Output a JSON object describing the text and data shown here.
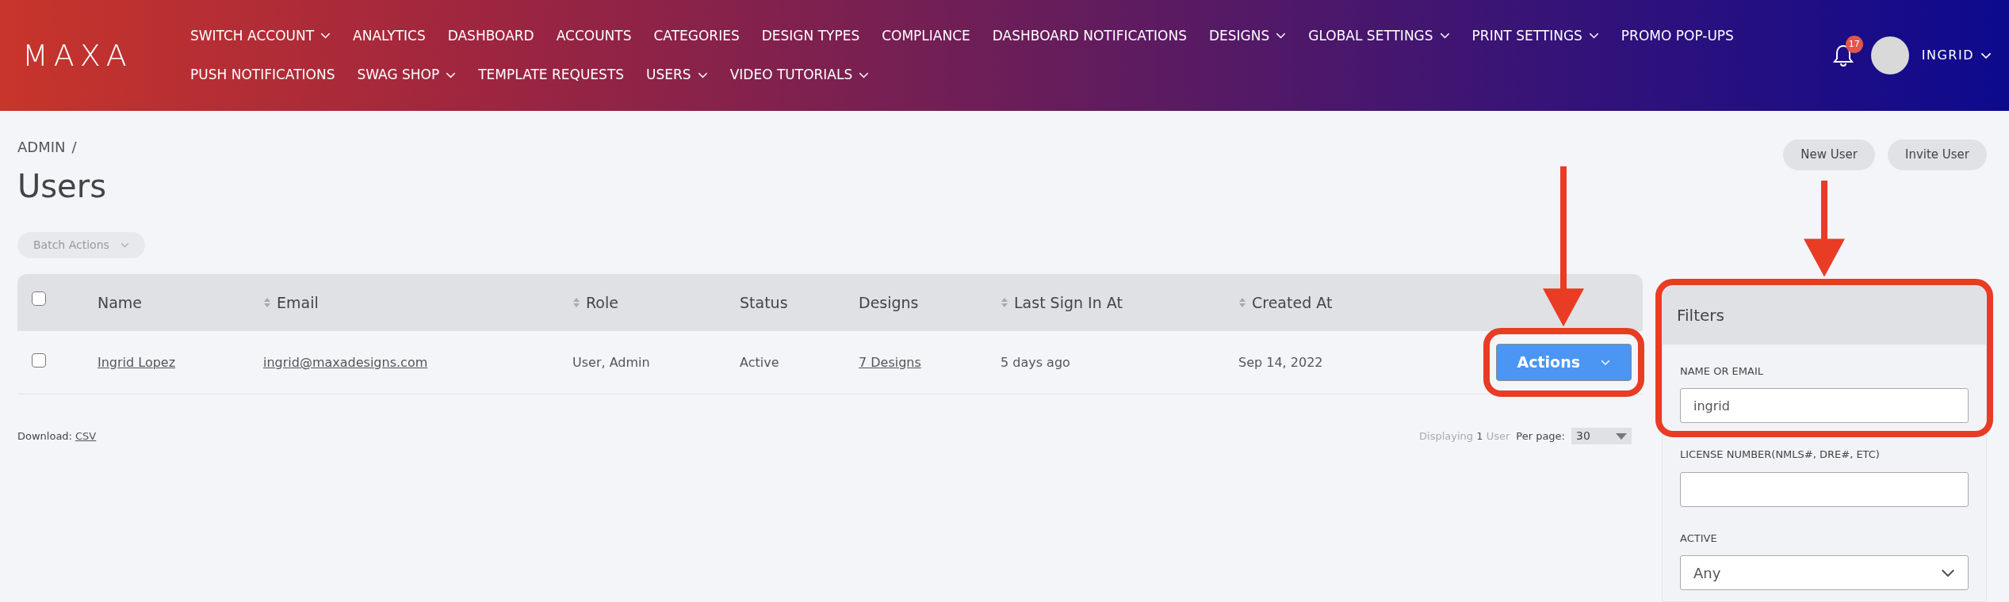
{
  "brand": "MAXA",
  "nav_rows": [
    [
      {
        "label": "SWITCH ACCOUNT",
        "dropdown": true
      },
      {
        "label": "ANALYTICS",
        "dropdown": false
      },
      {
        "label": "DASHBOARD",
        "dropdown": false
      },
      {
        "label": "ACCOUNTS",
        "dropdown": false
      },
      {
        "label": "CATEGORIES",
        "dropdown": false
      },
      {
        "label": "DESIGN TYPES",
        "dropdown": false
      },
      {
        "label": "COMPLIANCE",
        "dropdown": false
      },
      {
        "label": "DASHBOARD NOTIFICATIONS",
        "dropdown": false
      },
      {
        "label": "DESIGNS",
        "dropdown": true
      },
      {
        "label": "GLOBAL SETTINGS",
        "dropdown": true
      },
      {
        "label": "PRINT SETTINGS",
        "dropdown": true
      },
      {
        "label": "PROMO POP-UPS",
        "dropdown": false
      }
    ],
    [
      {
        "label": "PUSH NOTIFICATIONS",
        "dropdown": false
      },
      {
        "label": "SWAG SHOP",
        "dropdown": true
      },
      {
        "label": "TEMPLATE REQUESTS",
        "dropdown": false
      },
      {
        "label": "USERS",
        "dropdown": true
      },
      {
        "label": "VIDEO TUTORIALS",
        "dropdown": true
      }
    ]
  ],
  "notifications": {
    "count": "17"
  },
  "user": {
    "name": "INGRID"
  },
  "breadcrumb": {
    "label": "ADMIN",
    "separator": "/"
  },
  "title": "Users",
  "batch_actions": "Batch Actions",
  "header_buttons": [
    "New User",
    "Invite User"
  ],
  "table": {
    "header_checked": false,
    "columns": [
      {
        "label": "Name",
        "sortable": false
      },
      {
        "label": "Email",
        "sortable": true
      },
      {
        "label": "Role",
        "sortable": true
      },
      {
        "label": "Status",
        "sortable": false
      },
      {
        "label": "Designs",
        "sortable": false
      },
      {
        "label": "Last Sign In At",
        "sortable": true
      },
      {
        "label": "Created At",
        "sortable": true
      }
    ],
    "rows": [
      {
        "checked": false,
        "cells": [
          {
            "text": "Ingrid Lopez",
            "link": true
          },
          {
            "text": "ingrid@maxadesigns.com",
            "link": true
          },
          {
            "text": "User, Admin",
            "link": false
          },
          {
            "text": "Active",
            "link": false
          },
          {
            "text": "7 Designs",
            "link": true
          },
          {
            "text": "5 days ago",
            "link": false
          },
          {
            "text": "Sep 14, 2022",
            "link": false
          }
        ],
        "action": "Actions"
      }
    ]
  },
  "download": {
    "label": "Download:",
    "link": "CSV"
  },
  "pagination": {
    "prefix": "Displaying",
    "count": "1",
    "suffix": "User",
    "per_page_label": "Per page:",
    "per_page": "30"
  },
  "filters": {
    "title": "Filters",
    "fields": [
      {
        "label": "NAME OR EMAIL",
        "kind": "text",
        "value": "ingrid"
      },
      {
        "label": "LICENSE NUMBER(NMLS#, DRE#, ETC)",
        "kind": "text"
      },
      {
        "label": "ACTIVE",
        "kind": "select",
        "value": "Any"
      }
    ]
  }
}
